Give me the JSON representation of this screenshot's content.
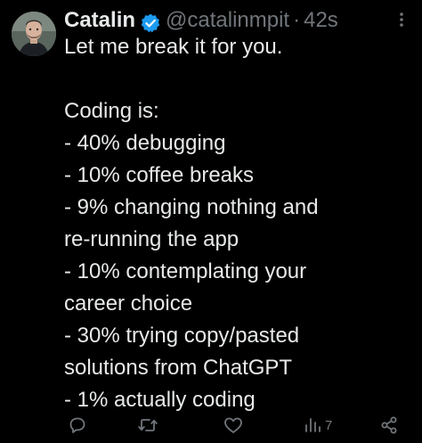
{
  "author": {
    "display_name": "Catalin",
    "handle": "@catalinmpit",
    "separator": "·",
    "time": "42s",
    "verified": true
  },
  "tweet": {
    "lines": [
      "Let me break it for you.",
      "",
      "Coding is:",
      "- 40% debugging",
      "- 10% coffee breaks",
      "- 9% changing nothing and",
      "re-running the app",
      "- 10% contemplating your",
      "career choice",
      "- 30% trying copy/pasted",
      "solutions from ChatGPT",
      "- 1% actually coding"
    ]
  },
  "actions": {
    "reply_icon": "reply-icon",
    "retweet_icon": "retweet-icon",
    "like_icon": "heart-icon",
    "views_icon": "views-chart-icon",
    "views_count": "7",
    "share_icon": "share-icon"
  },
  "colors": {
    "background": "#000000",
    "text": "#e7e9ea",
    "muted": "#71767b",
    "verified_badge": "#1d9bf0"
  }
}
